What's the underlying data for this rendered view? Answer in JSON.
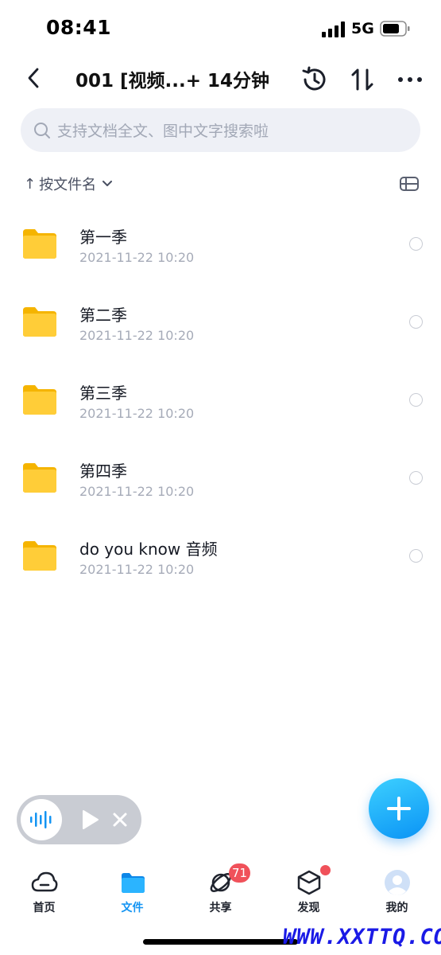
{
  "status_bar": {
    "time": "08:41",
    "network": "5G"
  },
  "header": {
    "title": "001 [视频...+ 14分钟"
  },
  "search": {
    "placeholder": "支持文档全文、图中文字搜索啦"
  },
  "sort": {
    "arrow": "↑",
    "label": "按文件名"
  },
  "files": [
    {
      "name": "第一季",
      "date": "2021-11-22 10:20",
      "icon": "folder-icon"
    },
    {
      "name": "第二季",
      "date": "2021-11-22 10:20",
      "icon": "folder-icon"
    },
    {
      "name": "第三季",
      "date": "2021-11-22 10:20",
      "icon": "folder-icon"
    },
    {
      "name": "第四季",
      "date": "2021-11-22 10:20",
      "icon": "folder-icon"
    },
    {
      "name": "do you know 音频",
      "date": "2021-11-22 10:20",
      "icon": "folder-icon"
    }
  ],
  "bottom_nav": [
    {
      "label": "首页",
      "icon": "cloud-icon"
    },
    {
      "label": "文件",
      "icon": "folder-icon",
      "active": true
    },
    {
      "label": "共享",
      "icon": "planet-icon",
      "badge": "71"
    },
    {
      "label": "发现",
      "icon": "cube-icon"
    },
    {
      "label": "我的",
      "icon": "avatar-icon"
    }
  ],
  "watermark": "WWW.XXTTQ.COM",
  "colors": {
    "accent": "#1394f3",
    "folder": "#ffc629",
    "badge": "#f0515a"
  }
}
